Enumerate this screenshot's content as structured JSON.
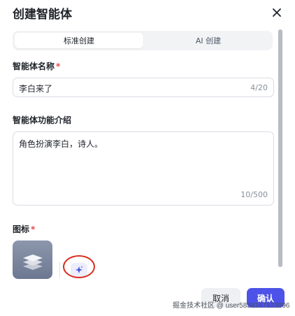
{
  "dialog": {
    "title": "创建智能体"
  },
  "tabs": [
    {
      "label": "标准创建",
      "active": true
    },
    {
      "label": "AI 创建",
      "active": false
    }
  ],
  "name_field": {
    "label": "智能体名称",
    "required_mark": "*",
    "value": "李白来了",
    "count": "4/20"
  },
  "description_field": {
    "label": "智能体功能介绍",
    "value": "角色扮演李白，诗人。",
    "count": "10/500"
  },
  "icon_field": {
    "label": "图标",
    "required_mark": "*",
    "icon": "layers-icon",
    "generate_icon": "sparkle-icon"
  },
  "footer": {
    "cancel_label": "取消",
    "confirm_label": "确认"
  },
  "watermark": "掘金技术社区 @ user5838167523996",
  "colors": {
    "primary": "#4d53e8",
    "required": "#e5484d",
    "highlight_ring": "#d92d20",
    "icon_tile": "#7a859c"
  }
}
